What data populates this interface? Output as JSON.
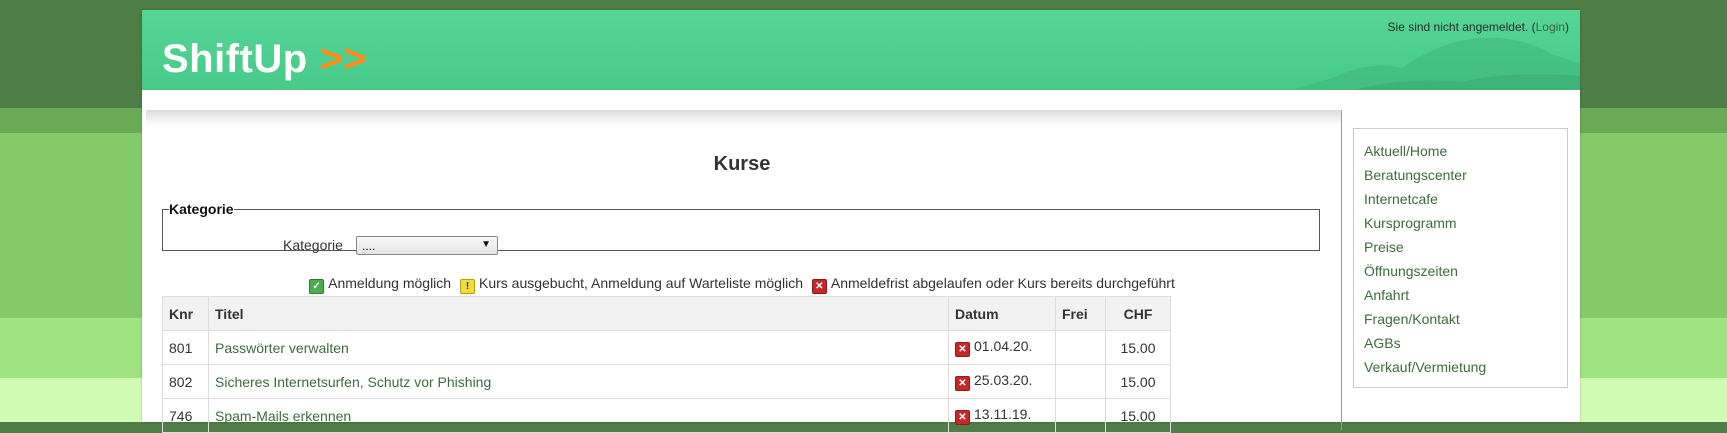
{
  "header": {
    "logo_text": "ShiftUp",
    "logo_arrows": ">>",
    "login_prefix": "Sie sind nicht angemeldet. (",
    "login_link": "Login",
    "login_suffix": ")"
  },
  "main": {
    "title": "Kurse",
    "filter": {
      "legend": "Kategorie",
      "label": "Kategorie",
      "selected": "...."
    },
    "legend": {
      "available": "Anmeldung möglich",
      "waitlist": "Kurs ausgebucht, Anmeldung auf Warteliste möglich",
      "closed": "Anmeldefrist abgelaufen oder Kurs bereits durchgeführt"
    },
    "table": {
      "headers": [
        "Knr",
        "Titel",
        "Datum",
        "Frei",
        "CHF"
      ],
      "rows": [
        {
          "knr": "801",
          "titel": "Passwörter verwalten",
          "status": "closed",
          "datum": "01.04.20.",
          "frei": "",
          "chf": "15.00"
        },
        {
          "knr": "802",
          "titel": "Sicheres Internetsurfen, Schutz vor Phishing",
          "status": "closed",
          "datum": "25.03.20.",
          "frei": "",
          "chf": "15.00"
        },
        {
          "knr": "746",
          "titel": "Spam-Mails erkennen",
          "status": "closed",
          "datum": "13.11.19.",
          "frei": "",
          "chf": "15.00"
        }
      ]
    }
  },
  "sidebar": {
    "items": [
      "Aktuell/Home",
      "Beratungscenter",
      "Internetcafe",
      "Kursprogramm",
      "Preise",
      "Öffnungszeiten",
      "Anfahrt",
      "Fragen/Kontakt",
      "AGBs",
      "Verkauf/Vermietung"
    ]
  },
  "colors": {
    "header_green": "#4fd190",
    "logo_arrow_orange": "#ff8c1a",
    "link_green": "#3e6b3e",
    "status_closed_red": "#c62828",
    "status_ok_green": "#47b04b",
    "status_warn_yellow": "#f3dc3a"
  },
  "icons": {
    "available": "check-icon",
    "waitlist": "exclamation-icon",
    "closed": "x-icon",
    "select_caret": "triangle-down-icon"
  }
}
